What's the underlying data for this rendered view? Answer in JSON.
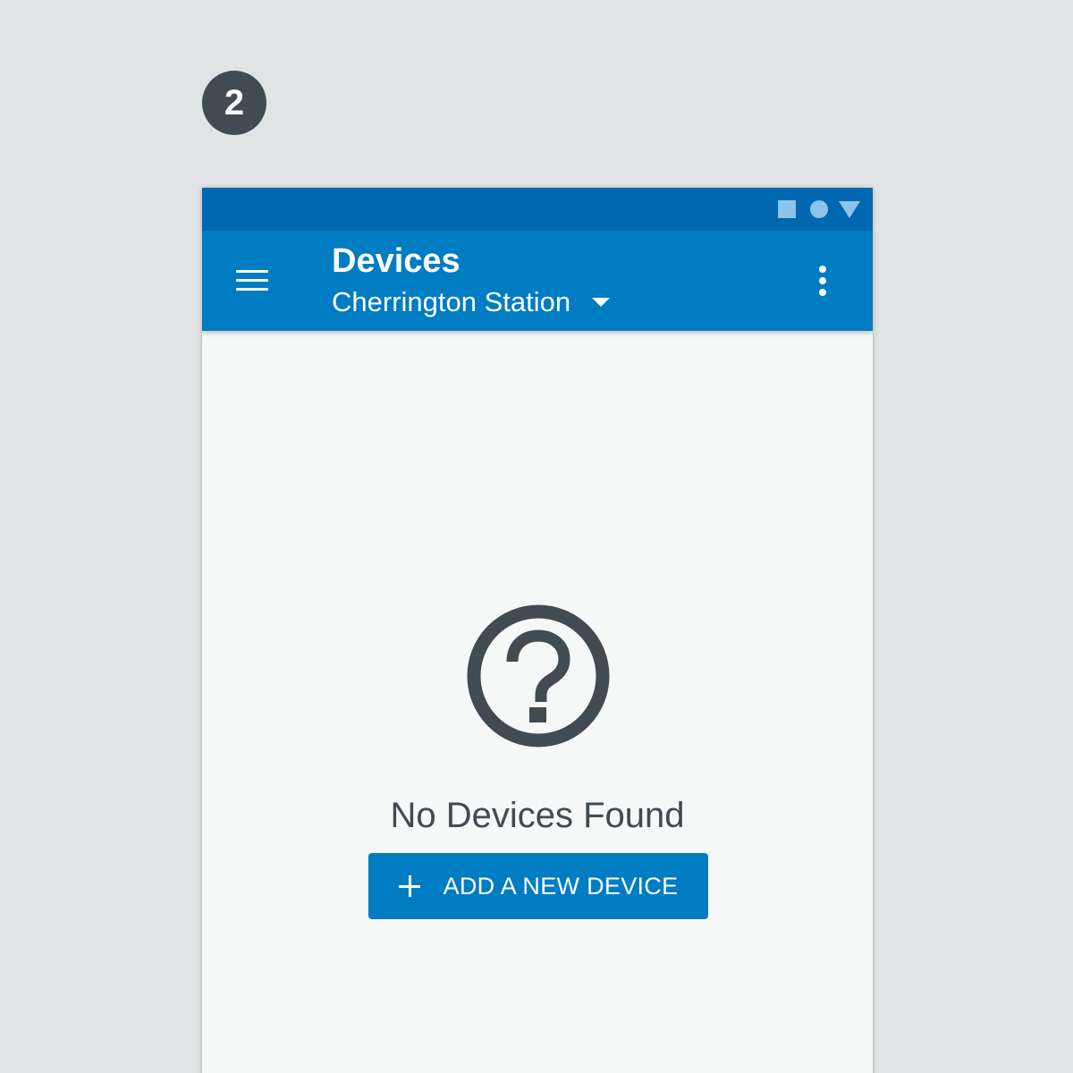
{
  "step": {
    "number": "2"
  },
  "status_bar": {
    "icons": [
      "square-icon",
      "circle-icon",
      "triangle-icon"
    ]
  },
  "app_bar": {
    "title": "Devices",
    "location": "Cherrington Station",
    "icons": {
      "menu": "hamburger-menu-icon",
      "dropdown": "dropdown-arrow-icon",
      "more": "more-vert-icon"
    }
  },
  "empty_state": {
    "icon": "help-circle-icon",
    "message": "No Devices Found",
    "button_label": "ADD A NEW DEVICE",
    "button_icon": "plus-icon"
  },
  "colors": {
    "page_background": "#e1e4e5",
    "status_bar": "#0067b1",
    "app_bar": "#007cc3",
    "status_icons": "#8ec3ea",
    "content_background": "#f6f7f7",
    "text_dark": "#414b51",
    "button": "#007cc3"
  }
}
